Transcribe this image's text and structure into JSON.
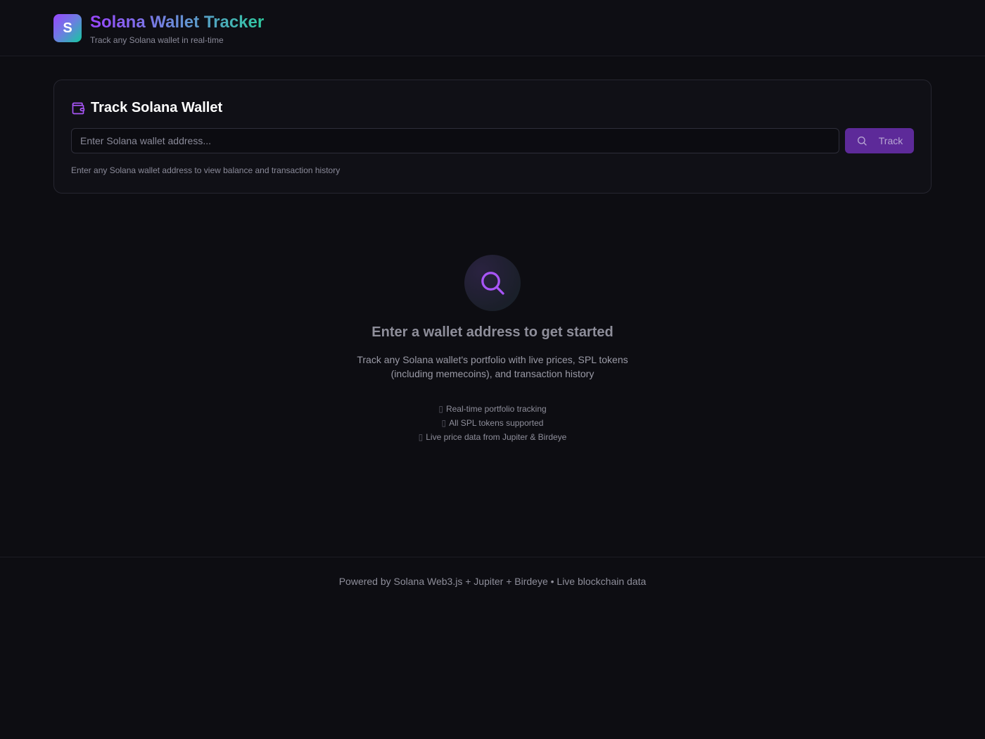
{
  "header": {
    "logo_letter": "S",
    "title": "Solana Wallet Tracker",
    "subtitle": "Track any Solana wallet in real-time"
  },
  "track_card": {
    "title": "Track Solana Wallet",
    "input_placeholder": "Enter Solana wallet address...",
    "input_value": "",
    "button_label": "Track",
    "helper_text": "Enter any Solana wallet address to view balance and transaction history"
  },
  "empty_state": {
    "icon": "search-icon",
    "title": "Enter a wallet address to get started",
    "description": "Track any Solana wallet's portfolio with live prices, SPL tokens (including memecoins), and transaction history",
    "features": [
      "Real-time portfolio tracking",
      "All SPL tokens supported",
      "Live price data from Jupiter & Birdeye"
    ]
  },
  "footer": {
    "text": "Powered by Solana Web3.js + Jupiter + Birdeye • Live blockchain data"
  },
  "colors": {
    "background": "#0d0d12",
    "accent_purple": "#9945ff",
    "accent_green": "#14c9a0",
    "button": "#5d2a99"
  }
}
